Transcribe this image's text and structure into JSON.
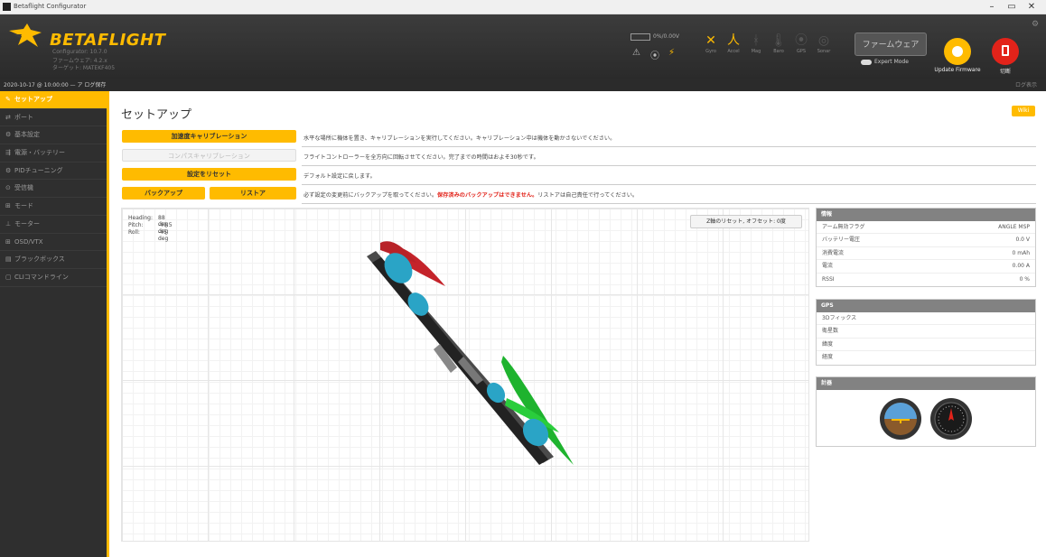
{
  "window": {
    "title": "Betaflight Configurator",
    "controls": [
      "–",
      "▭",
      "✕"
    ]
  },
  "brand": {
    "name": "BETAFLIGHT",
    "version_lines": [
      "Configurator: 10.7.0",
      "ファームウェア: 4.2.x",
      "ターゲット: MATEKF405"
    ]
  },
  "header": {
    "hw_label": "0%/0.00V",
    "hw_icons": [
      "⚠",
      "⦿",
      "⚡"
    ],
    "sensors": [
      {
        "glyph": "✕",
        "label": "Gyro",
        "active": true
      },
      {
        "glyph": "人",
        "label": "Accel",
        "active": true
      },
      {
        "glyph": "ᚼ",
        "label": "Mag",
        "active": false
      },
      {
        "glyph": "🌡",
        "label": "Baro",
        "active": false
      },
      {
        "glyph": "⦿",
        "label": "GPS",
        "active": false
      },
      {
        "glyph": "◎",
        "label": "Sonar",
        "active": false
      }
    ],
    "flash_button": "ファームウェア",
    "toggle_label": "Expert Mode",
    "update_label": "Update Firmware",
    "disconnect_label": "切断"
  },
  "statusbar": {
    "left": "2020-10-17 @ 10:00:00 — ア  ログ保存",
    "right": "ログ表示"
  },
  "nav": [
    {
      "icon": "✎",
      "label": "セットアップ",
      "active": true
    },
    {
      "icon": "⇄",
      "label": "ポート",
      "active": false
    },
    {
      "icon": "⚙",
      "label": "基本設定",
      "active": false
    },
    {
      "icon": "⇶",
      "label": "電源・バッテリー",
      "active": false
    },
    {
      "icon": "⚙",
      "label": "PIDチューニング",
      "active": false
    },
    {
      "icon": "⊙",
      "label": "受信機",
      "active": false
    },
    {
      "icon": "⊞",
      "label": "モード",
      "active": false
    },
    {
      "icon": "⊥",
      "label": "モーター",
      "active": false
    },
    {
      "icon": "⊞",
      "label": "OSD/VTX",
      "active": false
    },
    {
      "icon": "▤",
      "label": "ブラックボックス",
      "active": false
    },
    {
      "icon": "▢",
      "label": "CLIコマンドライン",
      "active": false
    }
  ],
  "page": {
    "title": "セットアップ",
    "wiki": "Wiki"
  },
  "actions": [
    {
      "button": "加速度キャリブレーション",
      "desc": "水平な場所に機体を置き、キャリブレーションを実行してください。キャリブレーション中は機体を動かさないでください。"
    },
    {
      "button": "コンパスキャリブレーション",
      "desc": "フライトコントローラーを全方向に回転させてください。完了までの時間はおよそ30秒です。"
    },
    {
      "button": "設定をリセット",
      "desc": "デフォルト設定に戻します。"
    },
    {
      "button_a": "バックアップ",
      "button_b": "リストア",
      "desc_pre": "必ず設定の変更前にバックアップを取ってください。",
      "desc_red": "保存済みのバックアップはできません。",
      "desc_post": "リストアは自己責任で行ってください。"
    }
  ],
  "attitude": [
    {
      "label": "Heading:",
      "value": "88 deg"
    },
    {
      "label": "Pitch:",
      "value": "-49.5 deg"
    },
    {
      "label": "Roll:",
      "value": "-45 deg"
    }
  ],
  "reset_z": "Z軸のリセット, オフセット: 0度",
  "info": {
    "title": "情報",
    "rows": [
      {
        "label": "アーム無効フラグ",
        "value": "ANGLE MSP"
      },
      {
        "label": "バッテリー電圧",
        "value": "0.0 V"
      },
      {
        "label": "消費電流",
        "value": "0 mAh"
      },
      {
        "label": "電流",
        "value": "0.00 A"
      },
      {
        "label": "RSSI",
        "value": "0 %"
      }
    ]
  },
  "gps": {
    "title": "GPS",
    "rows": [
      {
        "label": "3Dフィックス",
        "value": ""
      },
      {
        "label": "衛星数",
        "value": ""
      },
      {
        "label": "緯度",
        "value": ""
      },
      {
        "label": "経度",
        "value": ""
      }
    ]
  },
  "instruments": {
    "title": "計器"
  },
  "colors": {
    "accent": "#ffbb00",
    "dark": "#2f2f2f",
    "red": "#e2231a"
  }
}
